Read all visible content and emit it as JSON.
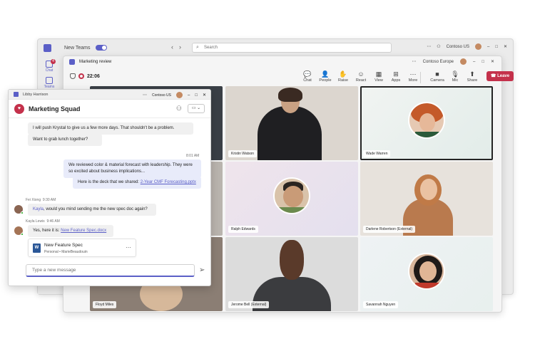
{
  "teams": {
    "title": "New Teams",
    "search_placeholder": "Search",
    "org": "Contoso US",
    "rail": [
      {
        "label": "Chat",
        "badge": "4"
      },
      {
        "label": "Teams"
      }
    ]
  },
  "meeting": {
    "title": "Marketing review",
    "org": "Contoso Europe",
    "timer": "22:06",
    "tools": [
      {
        "label": "Chat",
        "icon": "chat-icon",
        "glyph": "💬"
      },
      {
        "label": "People",
        "icon": "people-icon",
        "glyph": "👤"
      },
      {
        "label": "Raise",
        "icon": "raise-hand-icon",
        "glyph": "✋"
      },
      {
        "label": "React",
        "icon": "react-icon",
        "glyph": "☺"
      },
      {
        "label": "View",
        "icon": "view-icon",
        "glyph": "▦"
      },
      {
        "label": "Apps",
        "icon": "apps-icon",
        "glyph": "⊞"
      },
      {
        "label": "More",
        "icon": "more-icon",
        "glyph": "⋯"
      },
      {
        "label": "Camera",
        "icon": "camera-icon",
        "glyph": "■"
      },
      {
        "label": "Mic",
        "icon": "mic-icon",
        "glyph": "🎙"
      },
      {
        "label": "Share",
        "icon": "share-icon",
        "glyph": "⬆"
      }
    ],
    "leave_label": "Leave",
    "participants": [
      {
        "name": "",
        "style": "photo-dark"
      },
      {
        "name": "Kristin Watson",
        "style": "photo"
      },
      {
        "name": "Wade Warren",
        "style": "avatar"
      },
      {
        "name": "",
        "style": "photo-light"
      },
      {
        "name": "Ralph Edwards",
        "style": "avatar"
      },
      {
        "name": "Darlene Robertson (External)",
        "style": "photo"
      },
      {
        "name": "Floyd Miles",
        "style": "photo"
      },
      {
        "name": "Jerome Bell (External)",
        "style": "photo"
      },
      {
        "name": "Savannah Nguyen",
        "style": "avatar"
      }
    ]
  },
  "chat": {
    "window_user": "Libby Harrison",
    "org": "Contoso US",
    "title": "Marketing Squad",
    "messages": {
      "m1": "I will push Krystal to give us a few more days. That shouldn't be a problem.",
      "m2": "Want to grab lunch together?",
      "time1": "8:01 AM",
      "m3": "We reviewed color & material forecast with leadership. They were so excited about business implications...",
      "m4_prefix": "Here is the deck that we shared:",
      "m4_link": "2-Year CMF Forecasting.pptx",
      "sender1": "Fei Xiong",
      "sender1_time": "9:30 AM",
      "m5_mention": "Kayla",
      "m5_text": ", would you mind sending me the new spec doc again?",
      "sender2": "Kayla Lewis",
      "sender2_time": "9:46 AM",
      "m6_prefix": "Yes, here it is:",
      "m6_link": "New Feature Spec.docx"
    },
    "file": {
      "name": "New Feature Spec",
      "location": "Personal • MarieBeaudouin"
    },
    "compose_placeholder": "Type a new message"
  }
}
